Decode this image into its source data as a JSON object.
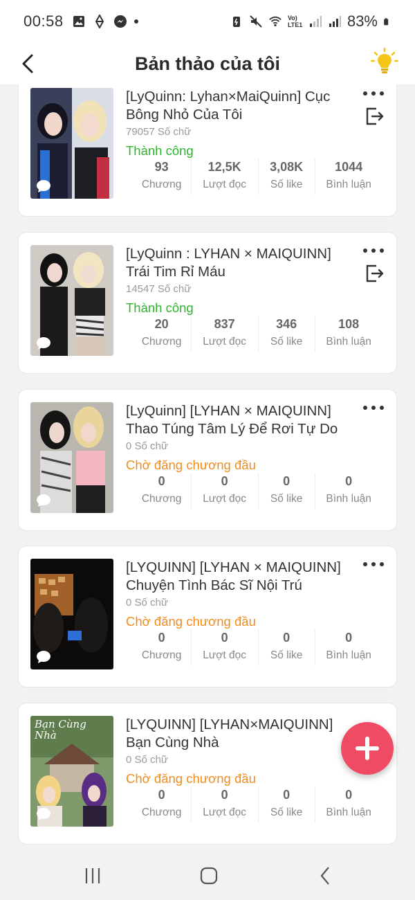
{
  "status_bar": {
    "time": "00:58",
    "network_label": "Vo) LTE1",
    "battery": "83%"
  },
  "header": {
    "title": "Bản thảo của tôi",
    "back_icon": "chevron-left-icon",
    "tip_icon": "lightbulb-icon"
  },
  "stat_labels": {
    "chapters": "Chương",
    "reads": "Lượt đọc",
    "likes": "Số like",
    "comments": "Bình luận"
  },
  "drafts": [
    {
      "title": "[LyQuinn: Lyhan×MaiQuinn] Cục Bông Nhỏ Của Tôi",
      "words": "79057 Số chữ",
      "status": "Thành công",
      "status_kind": "success",
      "chapters": "93",
      "reads": "12,5K",
      "likes": "3,08K",
      "comments": "1044"
    },
    {
      "title": "[LyQuinn : LYHAN × MAIQUINN] Trái Tim Rỉ Máu",
      "words": "14547 Số chữ",
      "status": "Thành công",
      "status_kind": "success",
      "chapters": "20",
      "reads": "837",
      "likes": "346",
      "comments": "108"
    },
    {
      "title": "[LyQuinn] [LYHAN × MAIQUINN] Thao Túng Tâm Lý Để Rơi Tự Do",
      "words": "0 Số chữ",
      "status": "Chờ đăng chương đầu",
      "status_kind": "pending",
      "chapters": "0",
      "reads": "0",
      "likes": "0",
      "comments": "0"
    },
    {
      "title": "[LYQUINN] [LYHAN × MAIQUINN] Chuyện Tình Bác Sĩ Nội Trú",
      "words": "0 Số chữ",
      "status": "Chờ đăng chương đầu",
      "status_kind": "pending",
      "chapters": "0",
      "reads": "0",
      "likes": "0",
      "comments": "0"
    },
    {
      "title": "[LYQUINN] [LYHAN×MAIQUINN] Bạn Cùng Nhà",
      "words": "0 Số chữ",
      "status": "Chờ đăng chương đầu",
      "status_kind": "pending",
      "chapters": "0",
      "reads": "0",
      "likes": "0",
      "comments": "0",
      "cover_text": "Bạn Cùng Nhà"
    }
  ],
  "colors": {
    "success": "#2db52d",
    "pending": "#f08c1a",
    "fab": "#ef4b64",
    "bulb": "#f5c518"
  },
  "fab_icon": "plus-icon",
  "nav_icons": [
    "recent-apps-icon",
    "home-icon",
    "back-icon"
  ]
}
